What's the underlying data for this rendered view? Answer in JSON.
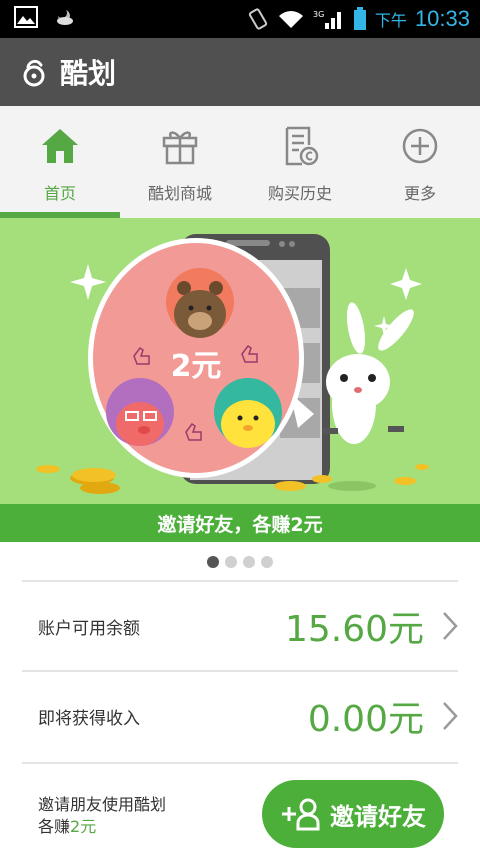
{
  "status_bar": {
    "time": "10:33",
    "ampm": "下午",
    "network": "3G"
  },
  "app_bar": {
    "title": "酷划"
  },
  "tabs": [
    {
      "label": "首页",
      "icon": "home-icon",
      "active": true
    },
    {
      "label": "酷划商城",
      "icon": "gift-icon",
      "active": false
    },
    {
      "label": "购买历史",
      "icon": "receipt-icon",
      "active": false
    },
    {
      "label": "更多",
      "icon": "plus-circle-icon",
      "active": false
    }
  ],
  "banner": {
    "bubble_text": "2元",
    "strip_text": "邀请好友，各赚2元",
    "page_count": 4,
    "active_page": 0
  },
  "account": {
    "balance_label": "账户可用余额",
    "balance_value": "15.60元",
    "upcoming_label": "即将获得收入",
    "upcoming_value": "0.00元"
  },
  "invite": {
    "line1": "邀请朋友使用酷划",
    "line2_prefix": "各赚",
    "line2_amount": "2元",
    "button_label": "邀请好友"
  },
  "colors": {
    "accent": "#55a843",
    "banner_bg": "#a4df7c",
    "appbar_bg": "#505050"
  }
}
